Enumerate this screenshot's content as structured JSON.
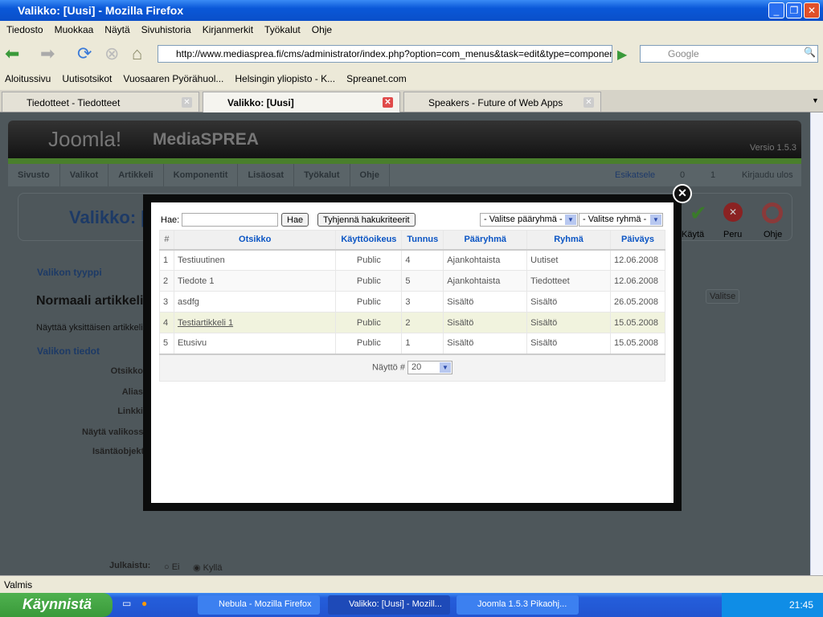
{
  "window": {
    "title": "Valikko: [Uusi] - Mozilla Firefox"
  },
  "menubar": [
    "Tiedosto",
    "Muokkaa",
    "Näytä",
    "Sivuhistoria",
    "Kirjanmerkit",
    "Työkalut",
    "Ohje"
  ],
  "url": "http://www.mediasprea.fi/cms/administrator/index.php?option=com_menus&task=edit&type=component&u",
  "search_placeholder": "Google",
  "bookmarks": [
    "Aloitussivu",
    "Uutisotsikot",
    "Vuosaaren Pyörähuol...",
    "Helsingin yliopisto - K...",
    "Spreanet.com"
  ],
  "tabs": [
    {
      "label": "Tiedotteet - Tiedotteet"
    },
    {
      "label": "Valikko: [Uusi]"
    },
    {
      "label": "Speakers - Future of Web Apps"
    }
  ],
  "joomla": {
    "logo": "Joomla!",
    "site": "MediaSPREA",
    "version": "Versio 1.5.3",
    "menu": [
      "Sivusto",
      "Valikot",
      "Artikkeli",
      "Komponentit",
      "Lisäosat",
      "Työkalut",
      "Ohje"
    ],
    "preview": "Esikatsele",
    "count1": "0",
    "count2": "1",
    "logout": "Kirjaudu ulos",
    "page_title": "Valikko: [",
    "toolbar": [
      "Käytä",
      "Peru",
      "Ohje"
    ],
    "type_legend": "Valikon tyyppi",
    "type_title": "Normaali artikkeli",
    "type_desc": "Näyttää yksittäisen artikkelin",
    "details_legend": "Valikon tiedot",
    "fields": [
      "Otsikko",
      "Alias",
      "Linkki",
      "Näytä valikossa",
      "Isäntäobjekti"
    ],
    "published_label": "Julkaistu:",
    "published_no": "Ei",
    "published_yes": "Kyllä",
    "select_button": "Valitse"
  },
  "modal": {
    "search_label": "Hae:",
    "search_value": "",
    "search_button": "Hae",
    "reset_button": "Tyhjennä hakukriteerit",
    "section_select": "- Valitse pääryhmä -",
    "category_select": "- Valitse ryhmä -",
    "columns": [
      "#",
      "Otsikko",
      "Käyttöoikeus",
      "Tunnus",
      "Pääryhmä",
      "Ryhmä",
      "Päiväys"
    ],
    "rows": [
      [
        "1",
        "Testiuutinen",
        "Public",
        "4",
        "Ajankohtaista",
        "Uutiset",
        "12.06.2008"
      ],
      [
        "2",
        "Tiedote 1",
        "Public",
        "5",
        "Ajankohtaista",
        "Tiedotteet",
        "12.06.2008"
      ],
      [
        "3",
        "asdfg",
        "Public",
        "3",
        "Sisältö",
        "Sisältö",
        "26.05.2008"
      ],
      [
        "4",
        "Testiartikkeli 1",
        "Public",
        "2",
        "Sisältö",
        "Sisältö",
        "15.05.2008"
      ],
      [
        "5",
        "Etusivu",
        "Public",
        "1",
        "Sisältö",
        "Sisältö",
        "15.05.2008"
      ]
    ],
    "display_label": "Näyttö #",
    "display_value": "20"
  },
  "status": "Valmis",
  "taskbar": {
    "start": "Käynnistä",
    "tasks": [
      "Nebula - Mozilla Firefox",
      "Valikko: [Uusi] - Mozill...",
      "Joomla 1.5.3 Pikaohj..."
    ],
    "clock": "21:45"
  }
}
